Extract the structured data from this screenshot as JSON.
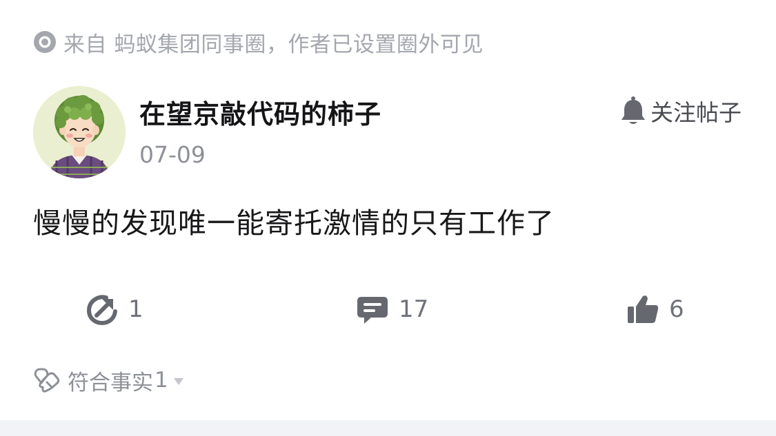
{
  "source": {
    "text": "来自 蚂蚁集团同事圈，作者已设置圈外可见",
    "icon": "circle-dot-icon"
  },
  "author": {
    "name": "在望京敲代码的柿子",
    "date": "07-09",
    "avatar": "cartoon-avatar"
  },
  "follow": {
    "label": "关注帖子",
    "icon": "bell-icon"
  },
  "post": {
    "content": "慢慢的发现唯一能寄托激情的只有工作了"
  },
  "actions": {
    "share": {
      "count": "1",
      "icon": "share-icon"
    },
    "comment": {
      "count": "17",
      "icon": "comment-icon"
    },
    "like": {
      "count": "6",
      "icon": "thumbs-up-icon"
    }
  },
  "factcheck": {
    "label": "符合事实",
    "count": "1",
    "icon": "handshake-heart-icon"
  },
  "colors": {
    "icon_gray": "#65686f",
    "muted_text": "#a4a7ae",
    "divider": "#f2f3f7",
    "avatar_bg": "#e9efd0",
    "hair_green": "#6b9a3f",
    "shirt_plaid": "#6a4c7e"
  }
}
